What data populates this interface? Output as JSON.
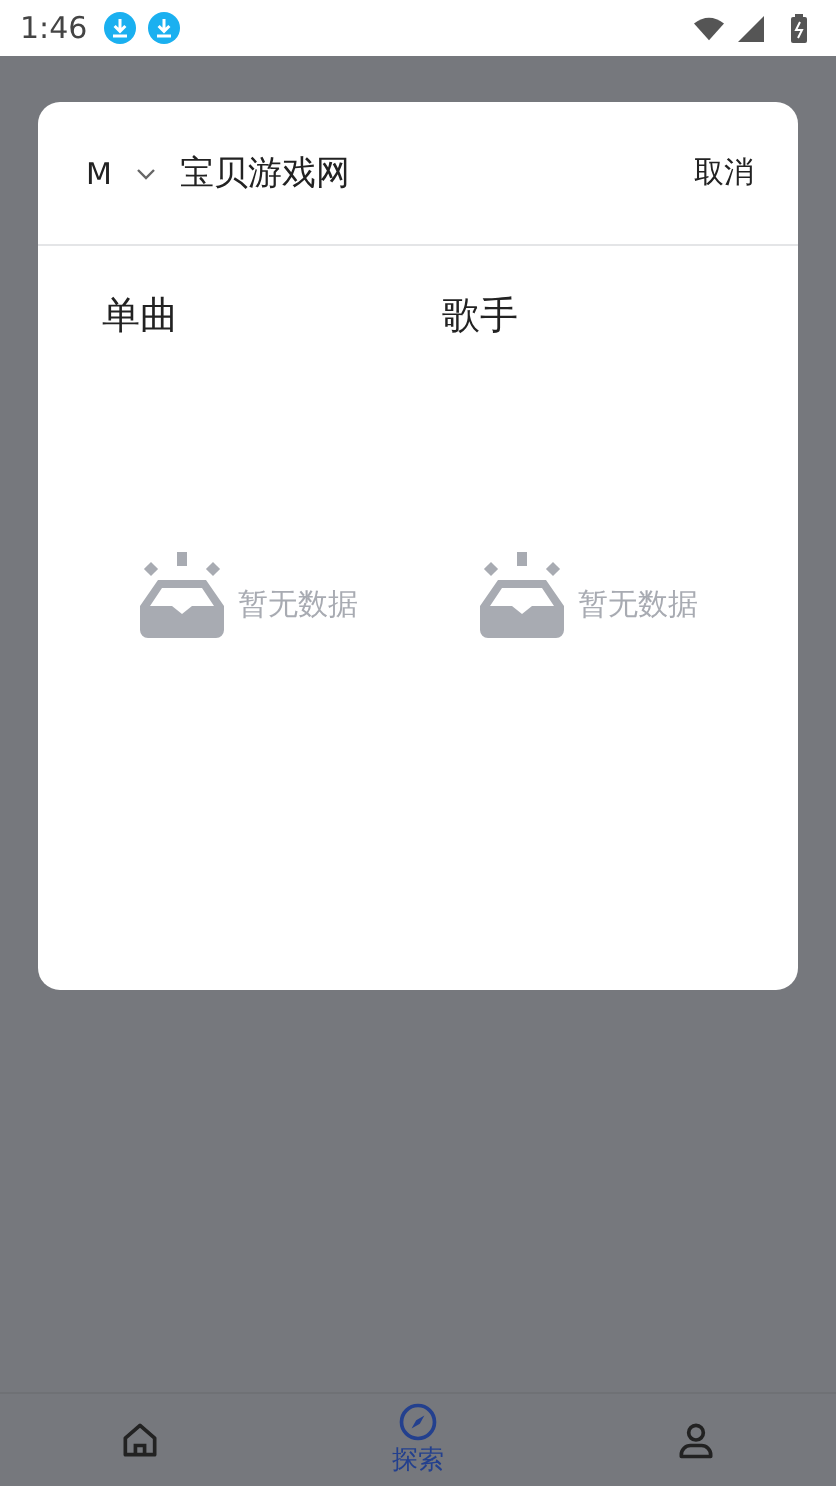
{
  "status_bar": {
    "time": "1:46"
  },
  "search": {
    "source": "M",
    "value": "宝贝游戏网",
    "cancel": "取消"
  },
  "columns": [
    {
      "title": "单曲",
      "empty_text": "暂无数据"
    },
    {
      "title": "歌手",
      "empty_text": "暂无数据"
    }
  ],
  "bottom_nav": [
    {
      "selected": false
    },
    {
      "selected": true,
      "label": "探索"
    },
    {
      "selected": false
    }
  ]
}
